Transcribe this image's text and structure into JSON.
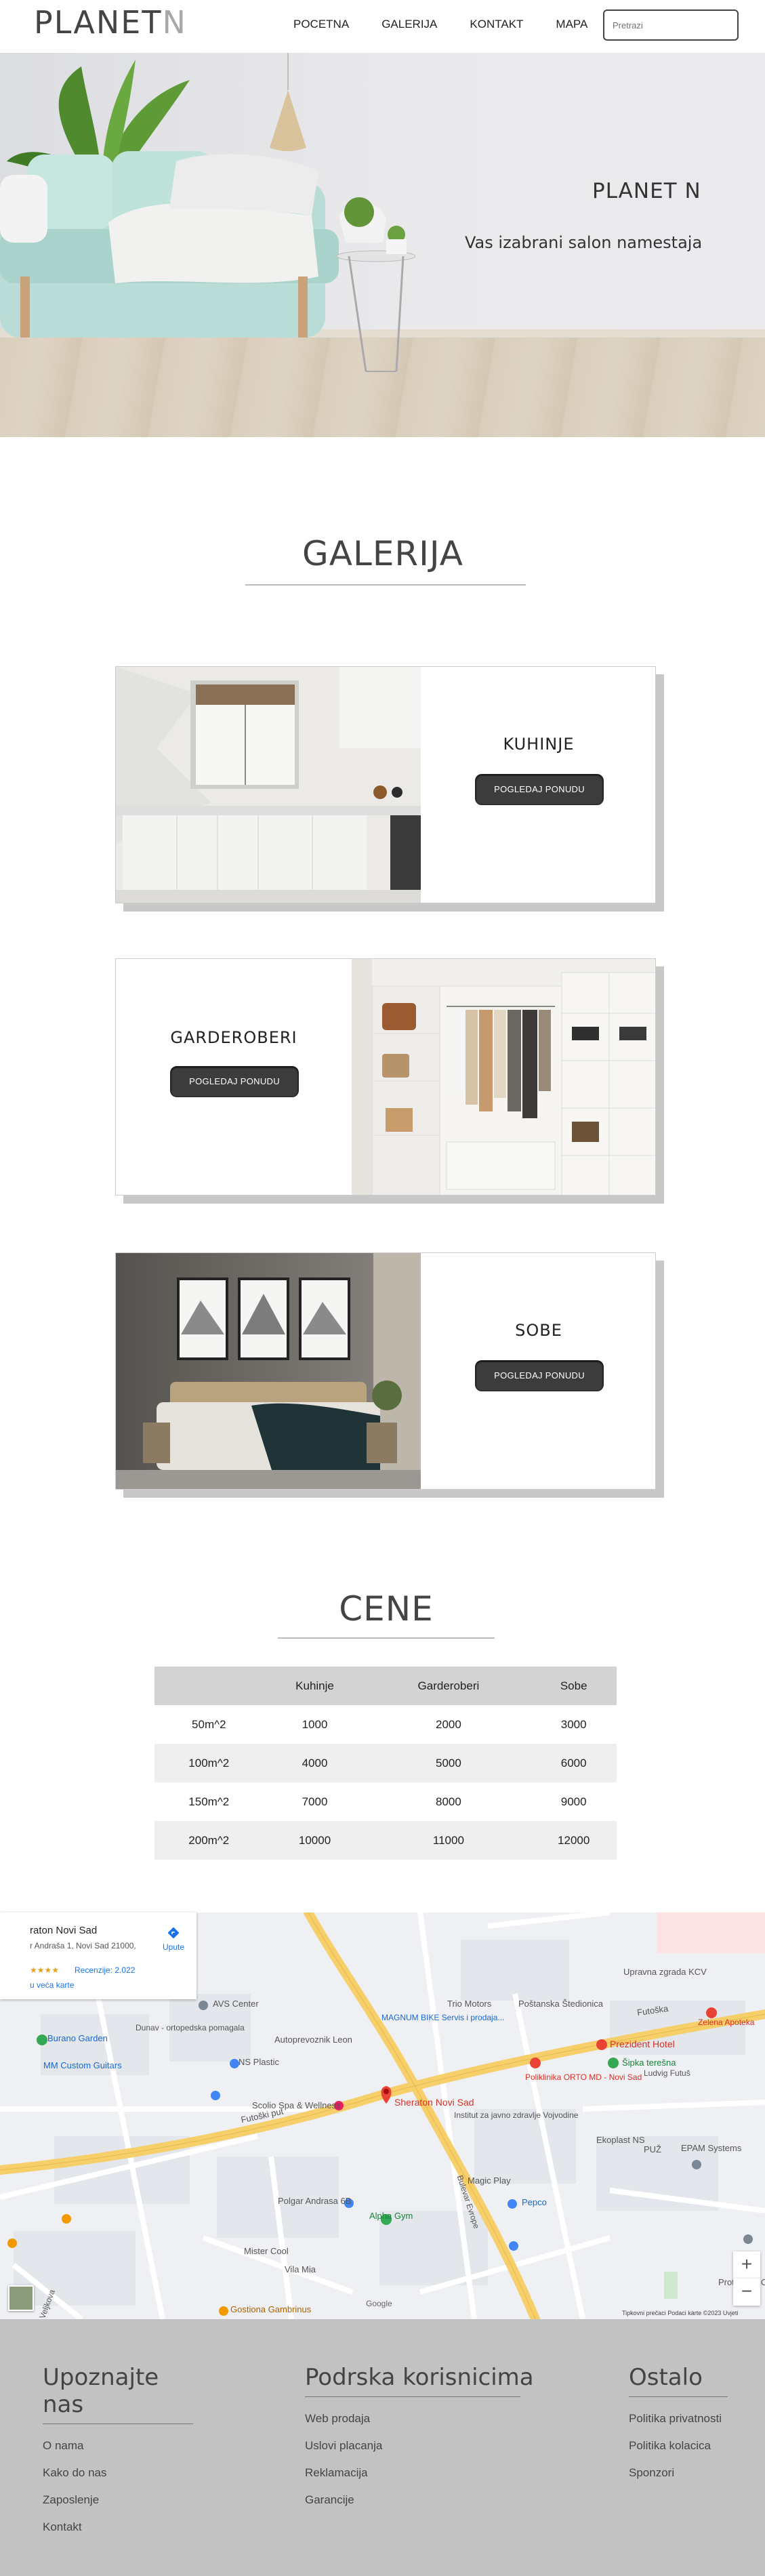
{
  "header": {
    "logo_main": "PLANET",
    "logo_accent": "N",
    "nav": [
      "POCETNA",
      "GALERIJA",
      "KONTAKT",
      "MAPA"
    ],
    "search_placeholder": "Pretrazi"
  },
  "hero": {
    "title": "PLANET N",
    "subtitle": "Vas izabrani salon namestaja"
  },
  "gallery": {
    "title": "GALERIJA",
    "cards": [
      {
        "label": "KUHINJE",
        "button": "POGLEDAJ PONUDU"
      },
      {
        "label": "GARDEROBERI",
        "button": "POGLEDAJ PONUDU"
      },
      {
        "label": "SOBE",
        "button": "POGLEDAJ PONUDU"
      }
    ]
  },
  "prices": {
    "title": "CENE",
    "headers": [
      "",
      "Kuhinje",
      "Garderoberi",
      "Sobe"
    ],
    "rows": [
      [
        "50m^2",
        "1000",
        "2000",
        "3000"
      ],
      [
        "100m^2",
        "4000",
        "5000",
        "6000"
      ],
      [
        "150m^2",
        "7000",
        "8000",
        "9000"
      ],
      [
        "200m^2",
        "10000",
        "11000",
        "12000"
      ]
    ]
  },
  "map": {
    "place_title": "raton Novi Sad",
    "place_address": "r Andraša 1, Novi Sad 21000,",
    "rating_stars": "★★★★",
    "reviews": "Recenzije: 2.022",
    "more_link": "u veća karte",
    "directions": "Upute",
    "labels": {
      "sheraton": "Sheraton Novi Sad",
      "futoska": "Futoška",
      "futoski_put": "Futoški put",
      "prezident": "Prezident Hotel",
      "sipka": "Šipka terešna",
      "poliklinika": "Poliklinika ORTO MD - Novi Sad",
      "epam": "EPAM Systems",
      "avs": "AVS Center",
      "scolio": "Scolio Spa & Wellness",
      "alpha": "Alpha Gym",
      "burano": "Burano Garden",
      "mm": "MM Custom Guitars",
      "trio": "Trio Motors",
      "magnum": "MAGNUM BIKE Servis i prodaja...",
      "postanska": "Poštanska Štedionica",
      "upravna": "Upravna zgrada KCV",
      "pepco": "Pepco",
      "gostiona": "Gostiona Gambrinus",
      "vila": "Vila Mia",
      "mister": "Mister Cool",
      "polgar": "Polgar Andrasa 6B",
      "zelena": "Zelena Apoteka",
      "ludvig": "Ludvig Futuš",
      "magic": "Magic Play",
      "bulevar": "Bulevar Evrope",
      "hajduk": "Hajduk Veljkova",
      "pluz": "PUŽ",
      "ekoplast": "Ekoplast NS",
      "institut": "Institut za javno zdravlje Vojvodine",
      "autoprevoz": "Autoprevoznik Leon",
      "dunav": "Dunav - ortopedska pomagala",
      "ns_plastic": "NS Plastic",
      "protestant": "Protestant Christian Fellowship",
      "google": "Google",
      "attribution": "Tipkovni prečaci   Podaci karte ©2023   Uvjeti"
    }
  },
  "footer": {
    "col1": {
      "title": "Upoznajte nas",
      "links": [
        "O nama",
        "Kako do nas",
        "Zaposlenje",
        "Kontakt"
      ]
    },
    "col2": {
      "title": "Podrska korisnicima",
      "links": [
        "Web prodaja",
        "Uslovi placanja",
        "Reklamacija",
        "Garancije"
      ]
    },
    "col3": {
      "title": "Ostalo",
      "links": [
        "Politika privatnosti",
        "Politika kolacica",
        "Sponzori"
      ]
    }
  },
  "colors": {
    "button": "#3c3c3c",
    "footer_bg": "#c2c2c2",
    "table_header": "#d3d3d3",
    "map_road": "#f6cf6b",
    "map_pin": "#ea4335"
  }
}
